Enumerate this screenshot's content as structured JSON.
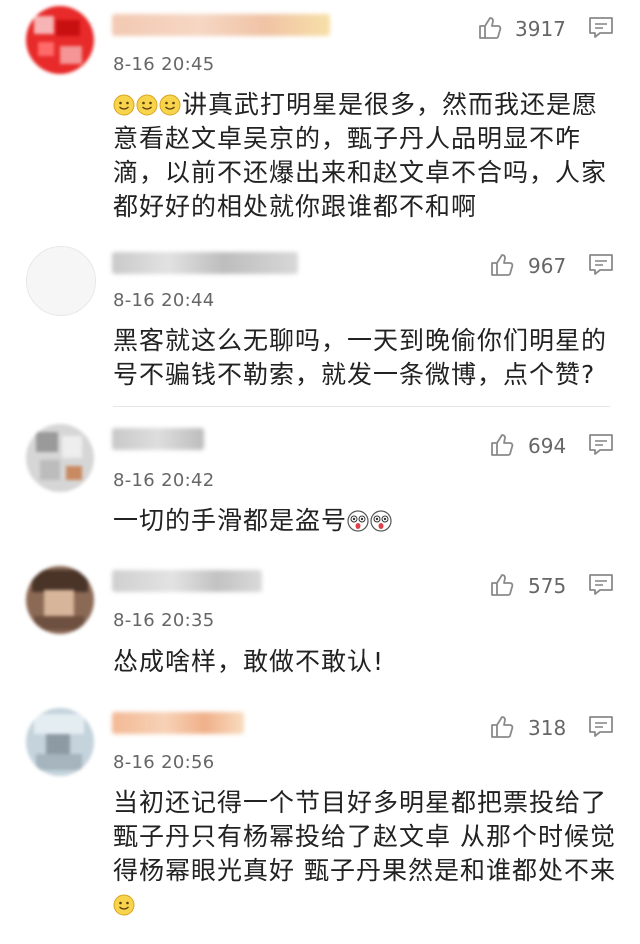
{
  "comments": [
    {
      "time": "8-16 20:45",
      "likes": "3917",
      "text": "讲真武打明星是很多，然而我还是愿意看赵文卓吴京的，甄子丹人品明显不咋滴，以前不还爆出来和赵文卓不合吗，人家都好好的相处就你跟谁都不和啊",
      "leading_emojis": [
        "smile-emoji",
        "smile-emoji",
        "smile-emoji"
      ]
    },
    {
      "time": "8-16 20:44",
      "likes": "967",
      "text": "黑客就这么无聊吗，一天到晚偷你们明星的号不骗钱不勒索，就发一条微博，点个赞?"
    },
    {
      "time": "8-16 20:42",
      "likes": "694",
      "text": "一切的手滑都是盗号",
      "trailing_emojis": [
        "shocked-emoji",
        "shocked-emoji"
      ]
    },
    {
      "time": "8-16 20:35",
      "likes": "575",
      "text": "怂成啥样，敢做不敢认!"
    },
    {
      "time": "8-16 20:56",
      "likes": "318",
      "text": "当初还记得一个节目好多明星都把票投给了甄子丹只有杨幂投给了赵文卓 从那个时候觉得杨幂眼光真好 甄子丹果然是和谁都处不来",
      "trailing_emojis": [
        "smile-emoji"
      ]
    }
  ],
  "icons": {
    "like": "thumbs-up-icon",
    "reply": "comment-icon"
  },
  "colors": {
    "text": "#222222",
    "meta": "#666666",
    "icon": "#8a8a8a",
    "avatar1": "#d92020"
  }
}
